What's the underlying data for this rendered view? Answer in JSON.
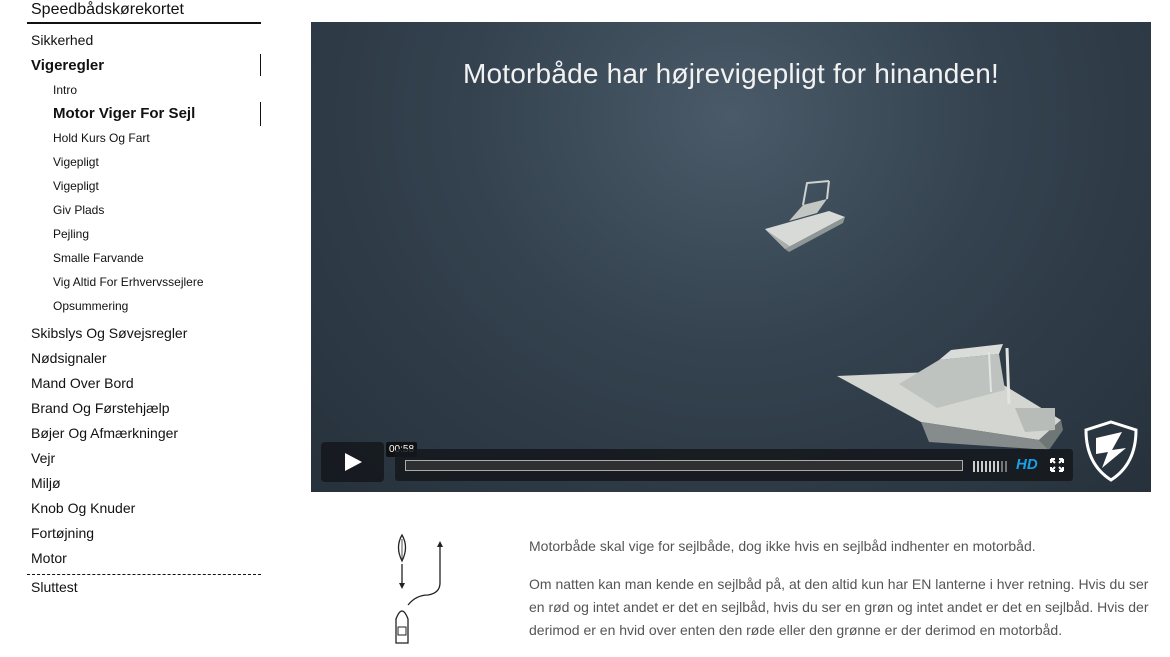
{
  "sidebar": {
    "site_title": "Speedbådskørekortet",
    "items_before": [
      "Sikkerhed",
      "Vigeregler"
    ],
    "sub_items": [
      "Intro",
      "Motor Viger For Sejl",
      "Hold Kurs Og Fart",
      "Vigepligt",
      "Vigepligt",
      "Giv Plads",
      "Pejling",
      "Smalle Farvande",
      "Vig Altid For Erhvervssejlere",
      "Opsummering"
    ],
    "items_after": [
      "Skibslys Og Søvejsregler",
      "Nødsignaler",
      "Mand Over Bord",
      "Brand Og Førstehjælp",
      "Bøjer Og Afmærkninger",
      "Vejr",
      "Miljø",
      "Knob Og Knuder",
      "Fortøjning",
      "Motor"
    ],
    "final_item": "Sluttest"
  },
  "video": {
    "caption": "Motorbåde har højrevigepligt for hinanden!",
    "time": "00:58",
    "hd_label": "HD",
    "progress": 0.0,
    "icons": [
      "play-icon",
      "volume-icon",
      "fullscreen-icon",
      "shield-logo-icon"
    ],
    "accent_color": "#1aa0e6"
  },
  "content": {
    "paragraphs": [
      "Motorbåde skal vige for sejlbåde, dog ikke hvis en sejlbåd indhenter en motorbåd.",
      "Om natten kan man kende en sejlbåd på, at den altid kun har EN lanterne i hver retning. Hvis du ser en rød og intet andet er det en sejlbåd, hvis du ser en grøn og intet andet er det en sejlbåd. Hvis der derimod er en hvid over enten den røde eller den grønne er der derimod en motorbåd."
    ]
  }
}
